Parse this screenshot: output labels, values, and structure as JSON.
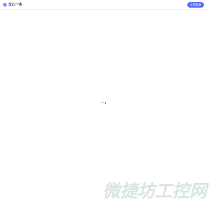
{
  "header": {
    "brand_name": "文心一言",
    "login_label": "立即登录"
  },
  "watermark": {
    "text": "微捷坊工控网"
  },
  "colors": {
    "accent": "#5b6cf2",
    "background": "#ffffff",
    "watermark": "#d8e6dc"
  },
  "icons": {
    "logo": "brand-logo-icon",
    "loader": "loading-dots-icon"
  }
}
